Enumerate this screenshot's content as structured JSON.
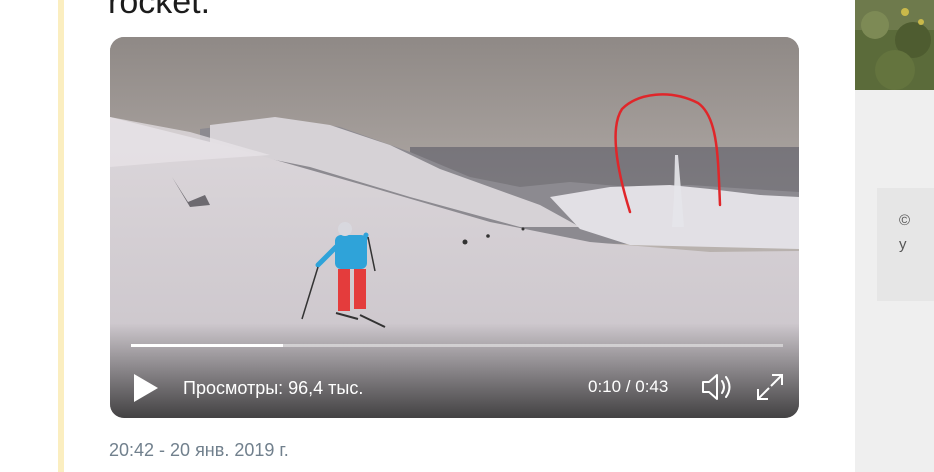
{
  "tweet": {
    "heading_text": "rocket.",
    "timestamp": "20:42 - 20 янв. 2019 г."
  },
  "video": {
    "views_label": "Просмотры: 96,4 тыс.",
    "time_display": "0:10 / 0:43",
    "progress_fraction": 0.233
  },
  "side": {
    "card_line1": "©",
    "card_line2": "у"
  },
  "icons": {
    "play": "play-icon",
    "volume": "volume-icon",
    "fullscreen": "fullscreen-icon"
  },
  "colors": {
    "accent": "#fbeec0",
    "timestamp_text": "#71808d",
    "annotation": "#e0262a"
  }
}
